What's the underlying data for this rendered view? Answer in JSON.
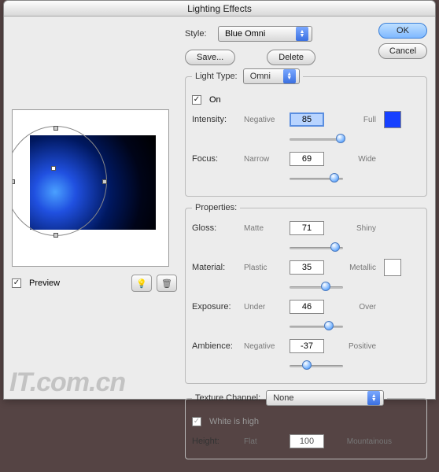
{
  "title": "Lighting Effects",
  "buttons": {
    "ok": "OK",
    "cancel": "Cancel",
    "save": "Save...",
    "delete": "Delete"
  },
  "style": {
    "label": "Style:",
    "value": "Blue Omni"
  },
  "lightType": {
    "legend": "Light Type:",
    "value": "Omni",
    "on_label": "On",
    "on_checked": true,
    "intensity": {
      "label": "Intensity:",
      "left": "Negative",
      "right": "Full",
      "value": "85",
      "pct": 96
    },
    "focus": {
      "label": "Focus:",
      "left": "Narrow",
      "right": "Wide",
      "value": "69",
      "pct": 84
    },
    "color": "#1640ff"
  },
  "properties": {
    "legend": "Properties:",
    "gloss": {
      "label": "Gloss:",
      "left": "Matte",
      "right": "Shiny",
      "value": "71",
      "pct": 85
    },
    "material": {
      "label": "Material:",
      "left": "Plastic",
      "right": "Metallic",
      "value": "35",
      "pct": 67
    },
    "exposure": {
      "label": "Exposure:",
      "left": "Under",
      "right": "Over",
      "value": "46",
      "pct": 73
    },
    "ambience": {
      "label": "Ambience:",
      "left": "Negative",
      "right": "Positive",
      "value": "-37",
      "pct": 32
    },
    "color": "#ffffff"
  },
  "texture": {
    "legend": "Texture Channel:",
    "value": "None",
    "white_label": "White is high",
    "white_checked": true,
    "height": {
      "label": "Height:",
      "left": "Flat",
      "right": "Mountainous",
      "value": "100"
    }
  },
  "preview": {
    "label": "Preview",
    "checked": true
  },
  "watermark": "IT.com.cn"
}
